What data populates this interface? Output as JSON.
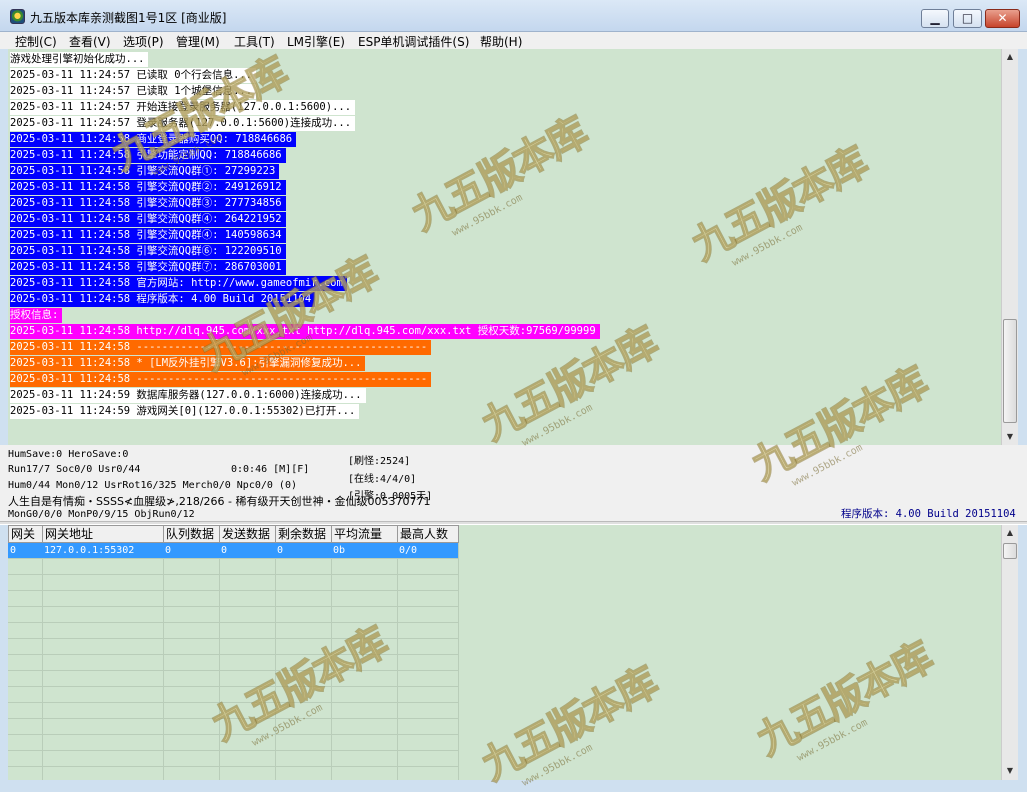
{
  "window": {
    "title": "九五版本库亲测截图1号1区 [商业版]",
    "min_glyph": "▁",
    "max_glyph": "□",
    "close_glyph": "✕"
  },
  "menu": [
    "控制(C)",
    "查看(V)",
    "选项(P)",
    "管理(M)",
    "工具(T)",
    "LM引擎(E)",
    "ESP单机调试插件(S)",
    "帮助(H)"
  ],
  "log_lines": [
    {
      "text": "游戏处理引擎初始化成功...",
      "style": "bg-white"
    },
    {
      "text": "2025-03-11 11:24:57 已读取 0个行会信息...",
      "style": "bg-white"
    },
    {
      "text": "2025-03-11 11:24:57 已读取 1个城堡信息...",
      "style": "bg-white"
    },
    {
      "text": "2025-03-11 11:24:57 开始连接登录服务器(127.0.0.1:5600)...",
      "style": "bg-white"
    },
    {
      "text": "2025-03-11 11:24:57 登录服务器(127.0.0.1:5600)连接成功...",
      "style": "bg-white"
    },
    {
      "text": "2025-03-11 11:24:58 商业登录器购买QQ: 718846686",
      "style": "bg-blue"
    },
    {
      "text": "2025-03-11 11:24:58 引擎功能定制QQ: 718846686",
      "style": "bg-blue"
    },
    {
      "text": "2025-03-11 11:24:58 引擎交流QQ群①: 27299223",
      "style": "bg-blue"
    },
    {
      "text": "2025-03-11 11:24:58 引擎交流QQ群②: 249126912",
      "style": "bg-blue"
    },
    {
      "text": "2025-03-11 11:24:58 引擎交流QQ群③: 277734856",
      "style": "bg-blue"
    },
    {
      "text": "2025-03-11 11:24:58 引擎交流QQ群④: 264221952",
      "style": "bg-blue"
    },
    {
      "text": "2025-03-11 11:24:58 引擎交流QQ群④: 140598634",
      "style": "bg-blue"
    },
    {
      "text": "2025-03-11 11:24:58 引擎交流QQ群⑥: 122209510",
      "style": "bg-blue"
    },
    {
      "text": "2025-03-11 11:24:58 引擎交流QQ群⑦: 286703001",
      "style": "bg-blue"
    },
    {
      "text": "2025-03-11 11:24:58 官方网站: http://www.gameofmir.com",
      "style": "bg-blue"
    },
    {
      "text": "2025-03-11 11:24:58 程序版本: 4.00 Build 20151104",
      "style": "bg-blue"
    },
    {
      "text": "授权信息:",
      "style": "bg-magenta"
    },
    {
      "text": "2025-03-11 11:24:58 http://dlq.945.com/xxx.txt http://dlq.945.com/xxx.txt 授权天数:97569/99999",
      "style": "bg-magenta"
    },
    {
      "text": "2025-03-11 11:24:58 ----------------------------------------------",
      "style": "bg-orange"
    },
    {
      "text": "2025-03-11 11:24:58 * [LM反外挂引擎V3.6]:引擎漏洞修复成功...",
      "style": "bg-orange"
    },
    {
      "text": "2025-03-11 11:24:58 ----------------------------------------------",
      "style": "bg-orange"
    },
    {
      "text": "2025-03-11 11:24:59 数据库服务器(127.0.0.1:6000)连接成功...",
      "style": "bg-white"
    },
    {
      "text": "2025-03-11 11:24:59 游戏网关[0](127.0.0.1:55302)已打开...",
      "style": "bg-white"
    }
  ],
  "status": {
    "humsave": "HumSave:0 HeroSave:0",
    "run": "Run17/7 Soc0/0 Usr0/44",
    "timer": "0:0:46 [M][F]",
    "monsters": "[刷怪:2524]",
    "online": "[在线:4/4/0]",
    "engine": "[引擎:0.0005天]",
    "hum": "Hum0/44 Mon0/12 UsrRot16/325 Merch0/0 Npc0/0 (0)",
    "life": "人生自是有情痴・SSSS≮血腥级≯,218/266 - 稀有级开天创世神・金仙级005370771",
    "mong": "MonG0/0/0 MonP0/9/15 ObjRun0/12",
    "version": "程序版本: 4.00 Build 20151104"
  },
  "table": {
    "columns": [
      "网关",
      "网关地址",
      "队列数据",
      "发送数据",
      "剩余数据",
      "平均流量",
      "最高人数"
    ],
    "rows": [
      [
        "0",
        "127.0.0.1:55302",
        "0",
        "0",
        "0",
        "0b",
        "0/0"
      ]
    ]
  },
  "scroll": {
    "up_glyph": "▲",
    "down_glyph": "▼"
  },
  "watermark": {
    "text": "九五版本库",
    "url": "www.95bbk.com"
  }
}
